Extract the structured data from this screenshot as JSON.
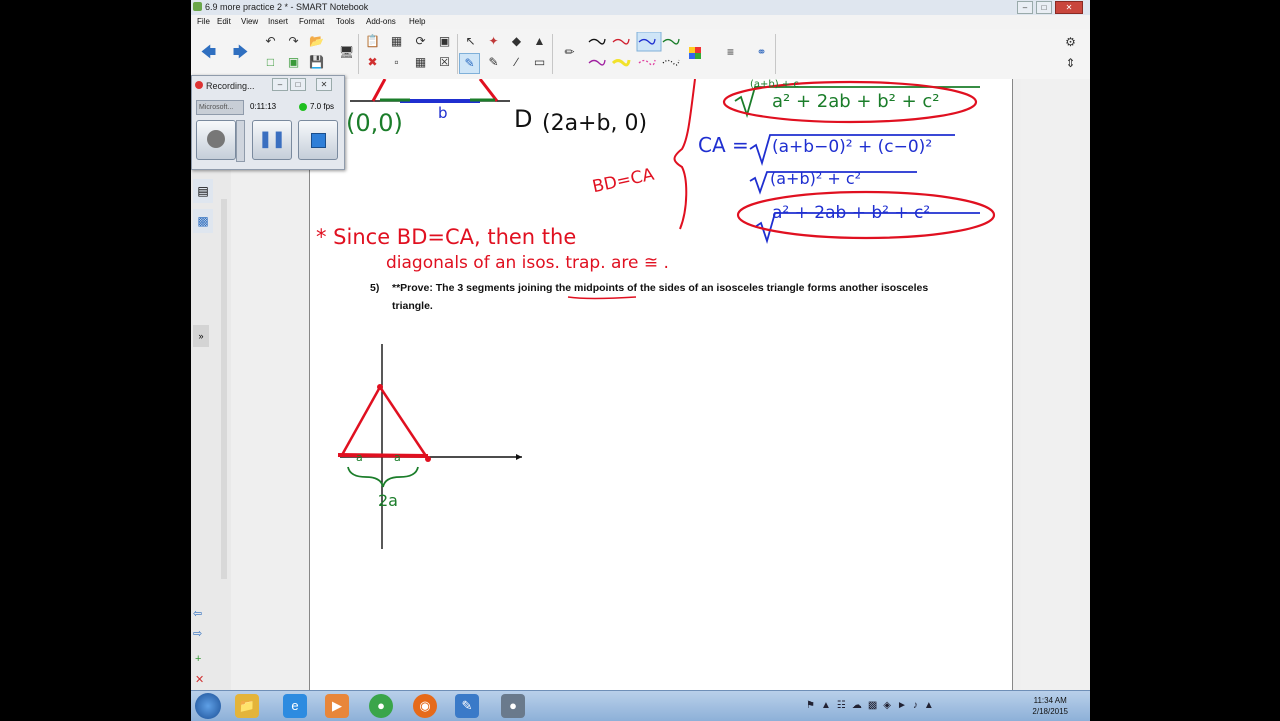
{
  "window": {
    "title": "6.9 more practice 2 * - SMART Notebook",
    "controls": [
      "minimize-icon",
      "maximize-icon",
      "close-icon"
    ]
  },
  "menu": [
    "File",
    "Edit",
    "View",
    "Insert",
    "Format",
    "Tools",
    "Add-ons",
    "Help"
  ],
  "recorder": {
    "title": "Recording...",
    "dropdown": "Microsoft...",
    "time": "0:11:13",
    "fps": "7.0 fps",
    "status_color": "#1fbf1f"
  },
  "colors": {
    "ink_red": "#e01020",
    "ink_blue": "#1f2fd0",
    "ink_green": "#1b7d2a",
    "ink_black": "#111111"
  },
  "problem": {
    "number": "5)",
    "prefix": "**Prove:  The 3 segments joining the ",
    "keyword": "midpoints",
    "suffix": " of the sides of an isosceles triangle forms another isosceles",
    "line2": "triangle."
  },
  "handwriting": {
    "origin_label": "(0,0)",
    "b_label": "b",
    "point_d": "D",
    "point_d_coords": "(2a+b, 0)",
    "ca_label": "CA =",
    "ca_expr": "(a+b−0)² + (c−0)²",
    "ca_expr2": "(a+b)² + c²",
    "top_expr_partial": "(a+b) + c",
    "boxed_top": "a² + 2ab + b² + c²",
    "boxed_bottom": "a² + 2ab + b² + c²",
    "bd_eq_ca": "BD=CA",
    "since_line1": "* Since BD=CA, then the",
    "since_line2": "diagonals of an isos. trap. are ≅ .",
    "midpoint_a1": "a",
    "midpoint_a2": "a",
    "two_a": "2a"
  },
  "taskbar": {
    "clock_time": "11:34 AM",
    "clock_date": "2/18/2015",
    "apps": [
      "start-orb",
      "file-explorer",
      "internet-explorer",
      "media-player",
      "chrome",
      "firefox",
      "smart-notebook",
      "smart-recorder"
    ]
  }
}
